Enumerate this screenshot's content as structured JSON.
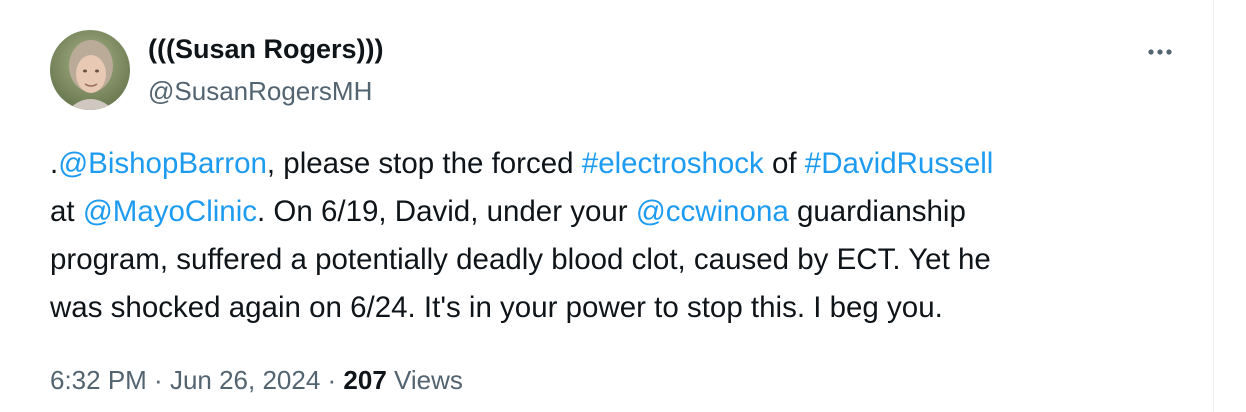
{
  "author": {
    "display_name": "(((Susan Rogers)))",
    "handle": "@SusanRogersMH"
  },
  "more_icon": "more-horizontal-icon",
  "tweet": {
    "lines": [
      [
        {
          "text": ".",
          "link": false
        },
        {
          "text": "@BishopBarron",
          "link": true
        },
        {
          "text": ", please stop the forced ",
          "link": false
        },
        {
          "text": "#electroshock",
          "link": true
        },
        {
          "text": " of ",
          "link": false
        },
        {
          "text": "#DavidRussell",
          "link": true
        }
      ],
      [
        {
          "text": "at ",
          "link": false
        },
        {
          "text": "@MayoClinic",
          "link": true
        },
        {
          "text": ". On 6/19, David, under your ",
          "link": false
        },
        {
          "text": "@ccwinona",
          "link": true
        },
        {
          "text": " guardianship",
          "link": false
        }
      ],
      [
        {
          "text": "program, suffered a potentially deadly blood clot, caused by ECT. Yet he",
          "link": false
        }
      ],
      [
        {
          "text": "was shocked again on 6/24. It's in your power to stop this. I beg you.",
          "link": false
        }
      ]
    ]
  },
  "meta": {
    "time": "6:32 PM",
    "separator": " · ",
    "date": "Jun 26, 2024",
    "views_count": "207",
    "views_label": " Views"
  },
  "colors": {
    "link": "#1d9bf0",
    "secondary": "#536471",
    "primary": "#0f1419"
  }
}
